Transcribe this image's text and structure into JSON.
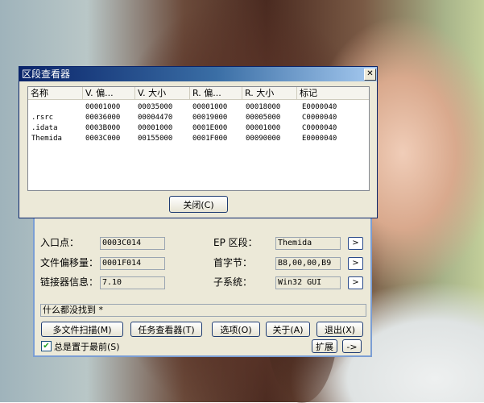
{
  "section_viewer": {
    "title": "区段查看器",
    "close_x": "✕",
    "columns": [
      "名称",
      "V. 偏...",
      "V. 大小",
      "R. 偏...",
      "R. 大小",
      "标记"
    ],
    "rows": [
      [
        "",
        "00001000",
        "00035000",
        "00001000",
        "00018000",
        "E0000040"
      ],
      [
        ".rsrc",
        "00036000",
        "00004470",
        "00019000",
        "00005000",
        "C0000040"
      ],
      [
        ".idata",
        "0003B000",
        "00001000",
        "0001E000",
        "00001000",
        "C0000040"
      ],
      [
        "Themida",
        "0003C000",
        "00155000",
        "0001F000",
        "00090000",
        "E0000040"
      ]
    ],
    "close_button": "关闭(C)"
  },
  "main": {
    "entry_point_label": "入口点：",
    "entry_point_value": "0003C014",
    "file_offset_label": "文件偏移量：",
    "file_offset_value": "0001F014",
    "linker_info_label": "链接器信息：",
    "linker_info_value": "7.10",
    "ep_section_label": "EP 区段：",
    "ep_section_value": "Themida",
    "first_bytes_label": "首字节：",
    "first_bytes_value": "B8,00,00,B9",
    "subsystem_label": "子系统：",
    "subsystem_value": "Win32 GUI",
    "arrow": ">",
    "status": "什么都没找到  *",
    "buttons": {
      "multi_scan": "多文件扫描(M)",
      "task_viewer": "任务查看器(T)",
      "options": "选项(O)",
      "about": "关于(A)",
      "exit": "退出(X)",
      "expand": "扩展",
      "more": "->"
    },
    "always_on_top": "总是置于最前(S)",
    "checkmark": "✔"
  }
}
